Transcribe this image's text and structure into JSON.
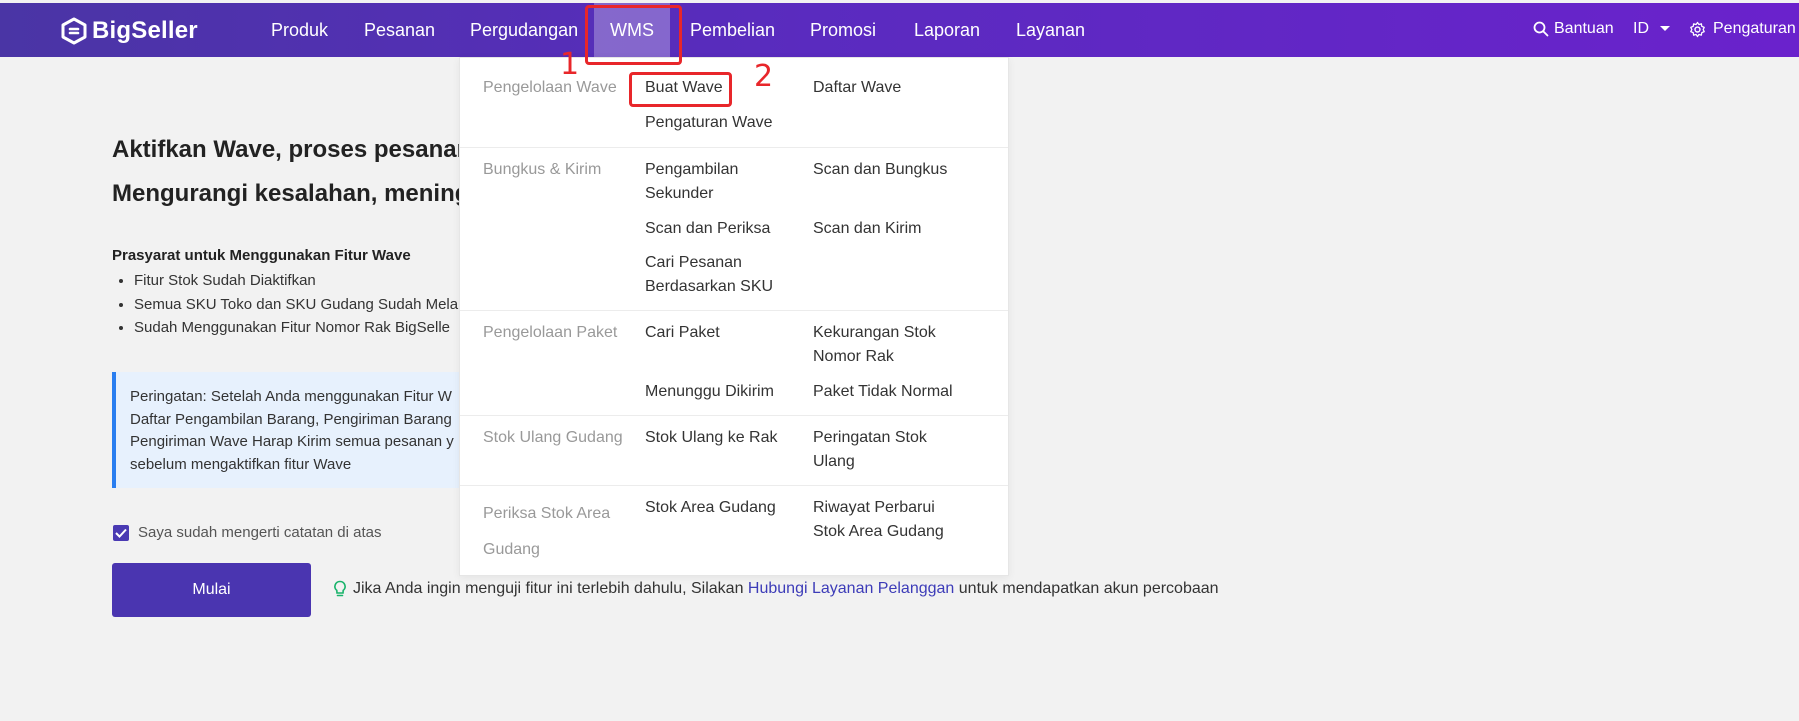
{
  "app": {
    "logo_text": "BigSeller"
  },
  "nav": {
    "items": [
      "Produk",
      "Pesanan",
      "Pergudangan",
      "WMS",
      "Pembelian",
      "Promosi",
      "Laporan",
      "Layanan"
    ],
    "active": "WMS"
  },
  "header_right": {
    "help": "Bantuan",
    "language": "ID",
    "settings": "Pengaturan"
  },
  "main": {
    "heading_line1": "Aktifkan Wave, proses pesanan",
    "heading_line2": "Mengurangi kesalahan, meningk",
    "prereq_title": "Prasyarat untuk Menggunakan Fitur Wave",
    "prereq_items": [
      "Fitur Stok Sudah Diaktifkan",
      "Semua SKU Toko dan SKU Gudang Sudah Mela",
      "Sudah Menggunakan Fitur Nomor Rak BigSelle"
    ],
    "warning_lines": [
      "Peringatan: Setelah Anda menggunakan Fitur W",
      "Daftar Pengambilan Barang, Pengiriman Barang",
      "Pengiriman Wave Harap Kirim semua pesanan y",
      "sebelum mengaktifkan fitur Wave"
    ],
    "checkbox_label": "Saya sudah mengerti catatan di atas",
    "start_button": "Mulai",
    "tip_prefix": "Jika Anda ingin menguji fitur ini terlebih dahulu, Silakan",
    "tip_link": "Hubungi Layanan Pelanggan",
    "tip_suffix": "untuk mendapatkan akun percobaan"
  },
  "dropdown": {
    "sections": [
      {
        "category": "Pengelolaan Wave",
        "items": [
          "Buat Wave",
          "Daftar Wave",
          "Pengaturan Wave"
        ]
      },
      {
        "category": "Bungkus & Kirim",
        "items": [
          "Pengambilan Sekunder",
          "Scan dan Bungkus",
          "Scan dan Periksa",
          "Scan dan Kirim",
          "Cari Pesanan Berdasarkan SKU"
        ]
      },
      {
        "category": "Pengelolaan Paket",
        "items": [
          "Cari Paket",
          "Kekurangan Stok Nomor Rak",
          "Menunggu Dikirim",
          "Paket Tidak Normal"
        ]
      },
      {
        "category": "Stok Ulang Gudang",
        "items": [
          "Stok Ulang ke Rak",
          "Peringatan Stok Ulang"
        ]
      },
      {
        "category": "Periksa Stok Area Gudang",
        "items": [
          "Stok Area Gudang",
          "Riwayat Perbarui Stok Area Gudang"
        ]
      }
    ]
  },
  "annotations": {
    "label_1": "1",
    "label_2": "2",
    "color": "#e8262a"
  },
  "colors": {
    "brand": "#4a35b0",
    "link": "#3d3cb8",
    "warning_border": "#2a7ef0"
  }
}
